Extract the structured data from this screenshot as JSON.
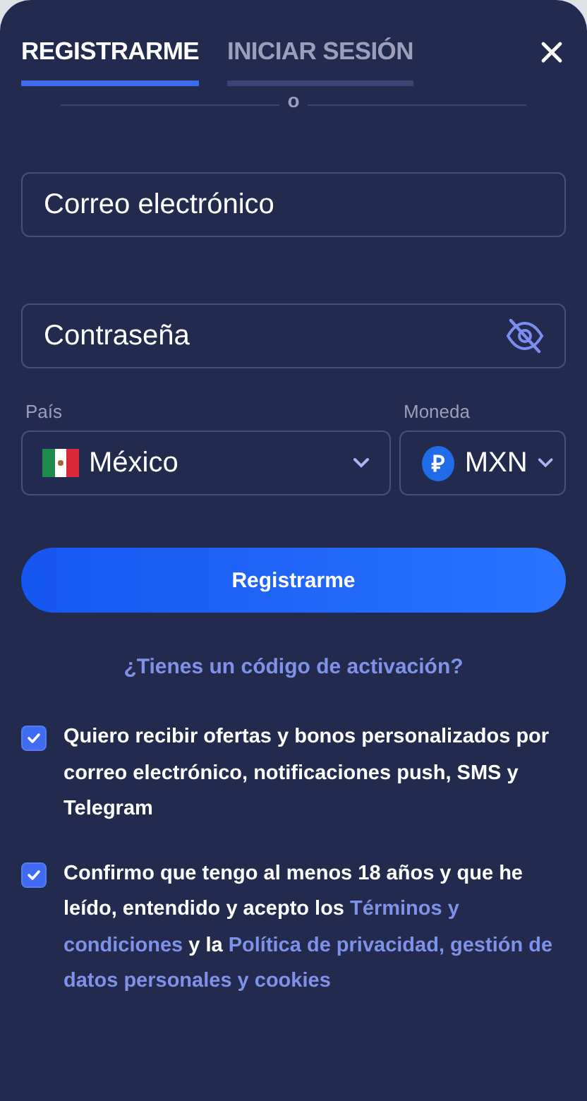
{
  "tabs": [
    {
      "label": "REGISTRARME",
      "selected": true
    },
    {
      "label": "INICIAR SESIÓN",
      "selected": false
    }
  ],
  "divider_text": "o",
  "email": {
    "placeholder": "Correo electrónico"
  },
  "password": {
    "placeholder": "Contraseña"
  },
  "country": {
    "label": "País",
    "value": "México"
  },
  "currency": {
    "label": "Moneda",
    "symbol": "₽",
    "value": "MXN"
  },
  "submit": "Registrarme",
  "activation_link": "¿Tienes un código de activación?",
  "consents": [
    {
      "checked": true,
      "parts": [
        {
          "kind": "text",
          "text": "Quiero recibir ofertas y bonos personalizados por correo electrónico, notificaciones push, SMS y Telegram"
        }
      ]
    },
    {
      "checked": true,
      "parts": [
        {
          "kind": "text",
          "text": "Confirmo que tengo al menos 18 años y que he leído, entendido y acepto los "
        },
        {
          "kind": "link",
          "text": "Términos y"
        },
        {
          "kind": "link",
          "text": "condiciones"
        },
        {
          "kind": "text",
          "text": " y la "
        },
        {
          "kind": "link",
          "text": "Política de privacidad,"
        },
        {
          "kind": "link",
          "text": "gestión de"
        },
        {
          "kind": "link",
          "text": "datos personales y cookies"
        }
      ]
    }
  ]
}
